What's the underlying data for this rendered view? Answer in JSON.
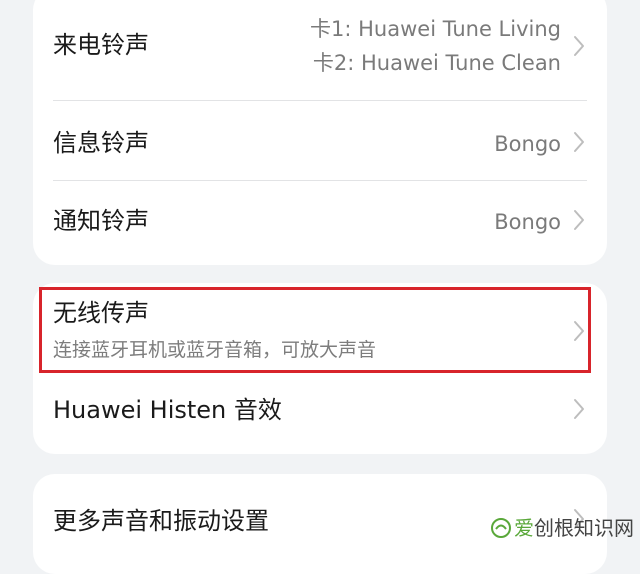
{
  "sound_settings": {
    "group1": {
      "ringtone": {
        "label": "来电铃声",
        "value_sim1": "卡1: Huawei Tune Living",
        "value_sim2": "卡2: Huawei Tune Clean",
        "chevron_icon": "chevron-right-icon"
      },
      "message_tone": {
        "label": "信息铃声",
        "value": "Bongo",
        "chevron_icon": "chevron-right-icon"
      },
      "notification_tone": {
        "label": "通知铃声",
        "value": "Bongo",
        "chevron_icon": "chevron-right-icon"
      }
    },
    "group2": {
      "wireless_audio": {
        "label": "无线传声",
        "description": "连接蓝牙耳机或蓝牙音箱，可放大声音",
        "chevron_icon": "chevron-right-icon"
      },
      "histen": {
        "label": "Huawei Histen 音效",
        "chevron_icon": "chevron-right-icon"
      }
    },
    "group3": {
      "more_settings": {
        "label": "更多声音和振动设置",
        "chevron_icon": "chevron-right-icon"
      }
    }
  },
  "annotation": {
    "highlight_color": "#d8242b"
  },
  "watermark": {
    "first_char": "爱",
    "rest_text": "创根知识网",
    "icon": "watermark-logo-icon"
  },
  "colors": {
    "background": "#f1f3f5",
    "card": "#ffffff",
    "primary_text": "#1a1a1a",
    "secondary_text": "#7a7a7a",
    "divider": "#e2e3e5"
  }
}
